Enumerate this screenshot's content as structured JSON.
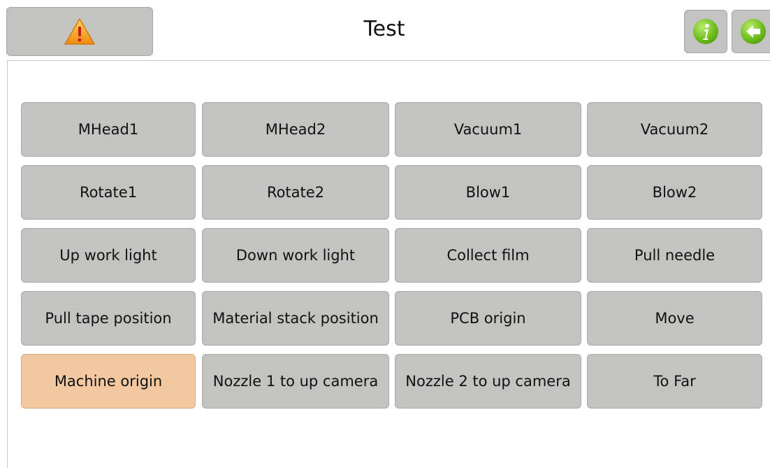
{
  "header": {
    "title": "Test",
    "warning_icon": "warning-triangle-icon",
    "info_icon": "info-icon",
    "back_icon": "back-arrow-icon"
  },
  "colors": {
    "button_bg": "#c3c4c2",
    "active_button_bg": "#f1c8a0",
    "icon_green": "#6cbc1c",
    "warning_orange": "#f59a1b"
  },
  "buttons": [
    [
      "MHead1",
      "MHead2",
      "Vacuum1",
      "Vacuum2"
    ],
    [
      "Rotate1",
      "Rotate2",
      "Blow1",
      "Blow2"
    ],
    [
      "Up work light",
      "Down work light",
      "Collect film",
      "Pull needle"
    ],
    [
      "Pull tape position",
      "Material stack position",
      "PCB origin",
      "Move"
    ],
    [
      "Machine origin",
      "Nozzle 1 to up camera",
      "Nozzle 2 to up camera",
      "To Far"
    ]
  ],
  "active_button": "Machine origin"
}
